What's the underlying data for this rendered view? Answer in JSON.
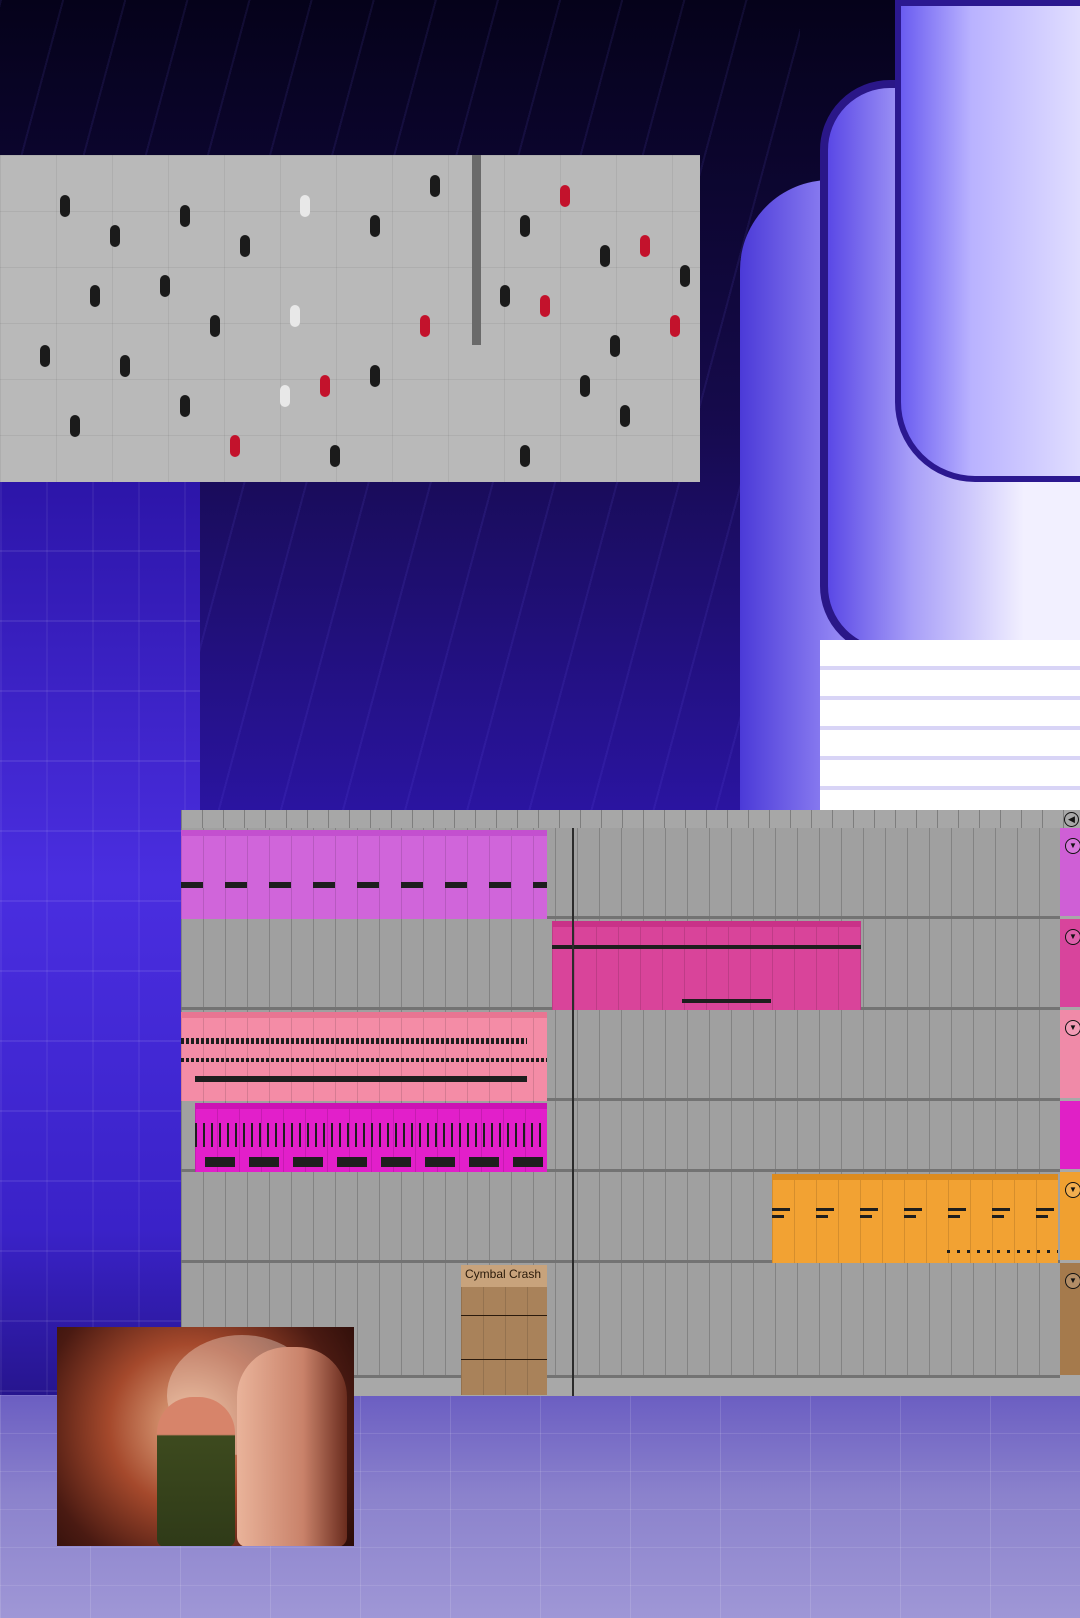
{
  "background": {
    "scene": "purple-lit-subway-station",
    "accent": "#3a22c0"
  },
  "crowd_video": {
    "panel": "video-overlay"
  },
  "film_still": {
    "panel": "video-overlay"
  },
  "daw": {
    "tracks": [
      {
        "color": "#cf5fd6",
        "clip_color": "#d065da",
        "clip_name": ""
      },
      {
        "color": "#d8449c",
        "clip_color": "#d9449a",
        "clip_name": ""
      },
      {
        "color": "#f08aa8",
        "clip_color": "#f48ca6",
        "clip_name": ""
      },
      {
        "color": "#e020c6",
        "clip_color": "#e21fca",
        "clip_name": ""
      },
      {
        "color": "#f0a030",
        "clip_color": "#f2a233",
        "clip_name": ""
      },
      {
        "color": "#a57a4c",
        "clip_color": "#a9825a",
        "clip_name": "Cymbal Crash"
      }
    ],
    "track_button_icon": "chevron-down-circle-icon",
    "corner_icon": "arrow-left-circle-icon"
  }
}
